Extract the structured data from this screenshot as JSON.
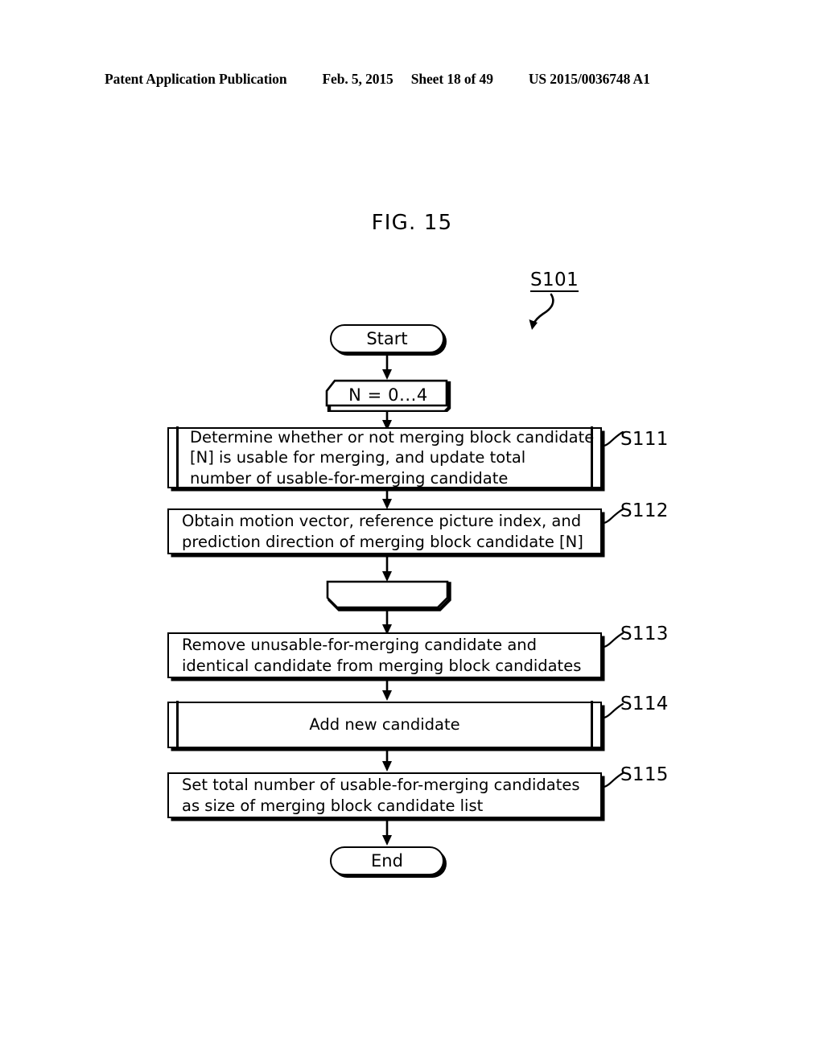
{
  "header": {
    "publication": "Patent Application Publication",
    "date": "Feb. 5, 2015",
    "sheet": "Sheet 18 of 49",
    "doc_number": "US 2015/0036748 A1"
  },
  "figure": {
    "title": "FIG. 15",
    "callout": "S101"
  },
  "flowchart": {
    "start": "Start",
    "loop_start": "N = 0...4",
    "loop_end": "",
    "end": "End",
    "steps": [
      {
        "id": "S111",
        "shape": "subroutine",
        "align": "left",
        "lines": [
          "Determine whether or not merging block candidate",
          "[N] is usable for merging, and update total",
          "number of usable-for-merging candidate"
        ]
      },
      {
        "id": "S112",
        "shape": "process",
        "align": "left",
        "lines": [
          "Obtain motion vector, reference picture index, and",
          "prediction direction of merging block candidate [N]"
        ]
      },
      {
        "id": "S113",
        "shape": "process",
        "align": "left",
        "lines": [
          "Remove unusable-for-merging candidate and",
          "identical candidate from merging block candidates"
        ]
      },
      {
        "id": "S114",
        "shape": "subroutine",
        "align": "center",
        "lines": [
          "Add new candidate"
        ]
      },
      {
        "id": "S115",
        "shape": "process",
        "align": "left",
        "lines": [
          "Set total number of usable-for-merging candidates",
          "as size of merging block candidate list"
        ]
      }
    ]
  },
  "colors": {
    "ink": "#000000",
    "paper": "#ffffff"
  }
}
